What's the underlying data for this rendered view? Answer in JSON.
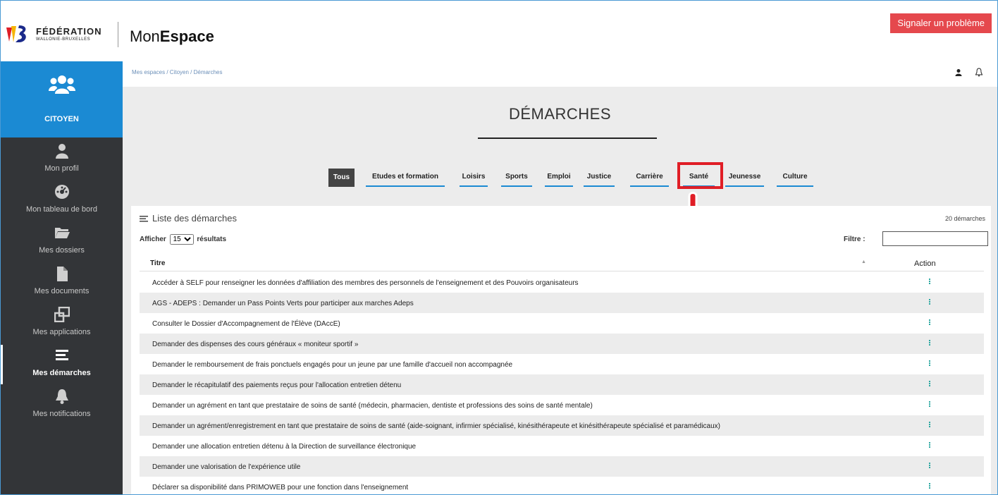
{
  "header": {
    "logo_line1": "FÉDÉRATION",
    "logo_line2": "WALLONIE-BRUXELLES",
    "app_title_regular": "Mon",
    "app_title_bold": "Espace",
    "report_button": "Signaler un problème"
  },
  "sidebar": {
    "top_label": "CITOYEN",
    "items": [
      {
        "label": "Mon profil",
        "icon": "user-icon"
      },
      {
        "label": "Mon tableau de bord",
        "icon": "dashboard-icon"
      },
      {
        "label": "Mes dossiers",
        "icon": "folder-icon"
      },
      {
        "label": "Mes documents",
        "icon": "document-icon"
      },
      {
        "label": "Mes applications",
        "icon": "applications-icon"
      },
      {
        "label": "Mes démarches",
        "icon": "list-icon",
        "active": true
      },
      {
        "label": "Mes notifications",
        "icon": "bell-icon"
      }
    ]
  },
  "breadcrumb": "Mes espaces / Citoyen / Démarches",
  "page_title": "DÉMARCHES",
  "tabs": [
    "Tous",
    "Etudes et formation",
    "Loisirs",
    "Sports",
    "Emploi",
    "Justice",
    "Carrière",
    "Santé",
    "Jeunesse",
    "Culture"
  ],
  "active_tab": "Tous",
  "highlighted_tab": "Santé",
  "list": {
    "title": "Liste des démarches",
    "count": "20 démarches",
    "show_prefix": "Afficher",
    "show_value": "15",
    "show_suffix": "résultats",
    "filter_label": "Filtre :",
    "col_title": "Titre",
    "col_action": "Action",
    "rows": [
      "Accéder à SELF pour renseigner les données d'affiliation des membres des personnels de l'enseignement et des Pouvoirs organisateurs",
      "AGS - ADEPS : Demander un Pass Points Verts pour participer aux marches Adeps",
      "Consulter le Dossier d'Accompagnement de l'Élève (DAccE)",
      "Demander des dispenses des cours généraux « moniteur sportif »",
      "Demander le remboursement de frais ponctuels engagés pour un jeune par une famille d'accueil non accompagnée",
      "Demander le récapitulatif des paiements reçus pour l'allocation entretien détenu",
      "Demander un agrément en tant que prestataire de soins de santé (médecin, pharmacien, dentiste et professions des soins de santé mentale)",
      "Demander un agrément/enregistrement en tant que prestataire de soins de santé (aide-soignant, infirmier spécialisé, kinésithérapeute et kinésithérapeute spécialisé et paramédicaux)",
      "Demander une allocation entretien détenu à la Direction de surveillance électronique",
      "Demander une valorisation de l'expérience utile",
      "Déclarer sa disponibilité dans PRIMOWEB pour une fonction dans l'enseignement"
    ]
  },
  "colors": {
    "accent_blue": "#1b8ad3",
    "sidebar_bg": "#333538",
    "report_red": "#e5484d",
    "highlight_red": "#e01e26"
  }
}
